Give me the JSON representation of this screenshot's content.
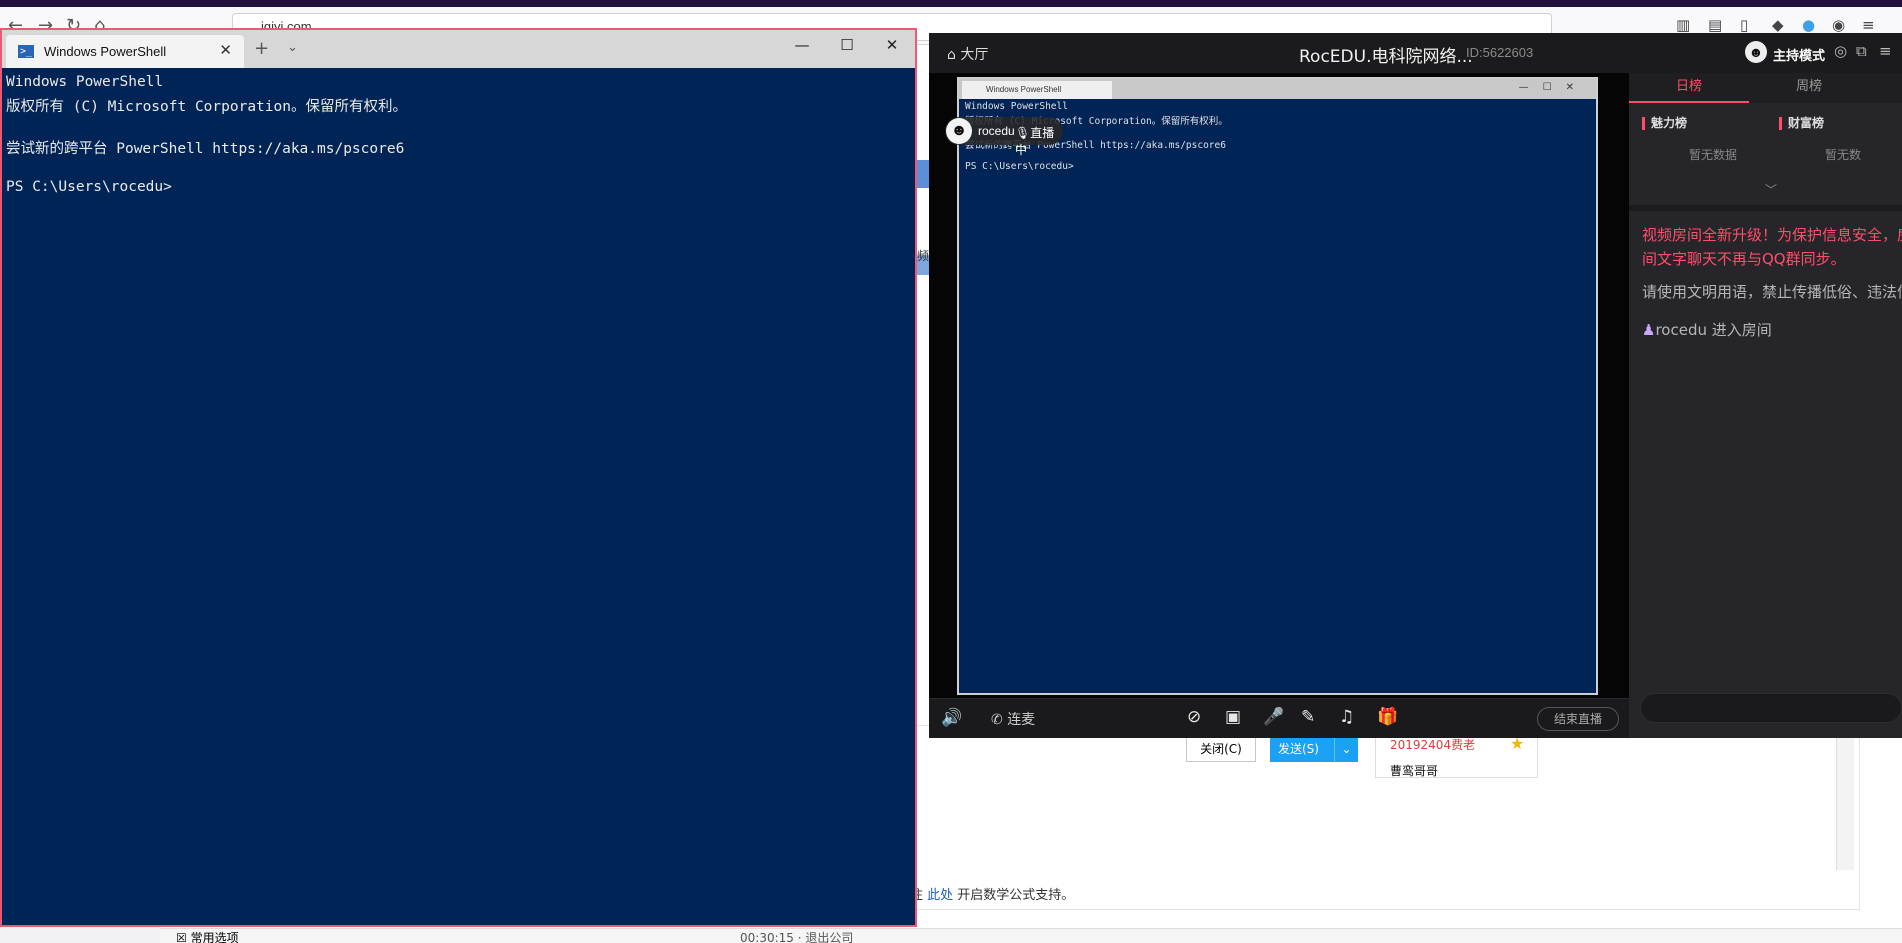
{
  "browser": {
    "url": "iqiyi.com",
    "footnote_prefix": "注 ",
    "footnote_link": "此处",
    "footnote_suffix": " 开启数学公式支持。",
    "common_options": "常用选项",
    "bottom_right_text": "00:30:15 · 退出公司",
    "left_fragment": "视频",
    "close_button": "关闭(C)",
    "send_button": "发送(S)",
    "chat_items": [
      "20192404费老",
      "曹鸾哥哥"
    ]
  },
  "powershell": {
    "tab_title": "Windows PowerShell",
    "console_lines": [
      "Windows PowerShell",
      "版权所有 (C) Microsoft Corporation。保留所有权利。",
      "",
      "尝试新的跨平台 PowerShell https://aka.ms/pscore6",
      "",
      "PS C:\\Users\\rocedu>"
    ]
  },
  "live": {
    "hall_label": "大厅",
    "room_title": "RocEDU.电科院网络...",
    "room_id": "ID:5622603",
    "host_mode": "主持模式",
    "streamer_name": "rocedu",
    "live_status": "直播中",
    "preview_tab": "Windows PowerShell",
    "connect_label": "连麦",
    "end_live": "结束直播",
    "tabs": {
      "daily": "日榜",
      "weekly": "周榜"
    },
    "rank_charm": "魅力榜",
    "rank_wealth": "财富榜",
    "no_data": "暂无数据",
    "no_data_cut": "暂无数",
    "notice_red": "视频房间全新升级！为保护信息安全，房间文字聊天不再与QQ群同步。",
    "notice_rules": "请使用文明用语，禁止传播低俗、违法信息。",
    "enter_user": "rocedu",
    "enter_text": " 进入房间"
  }
}
